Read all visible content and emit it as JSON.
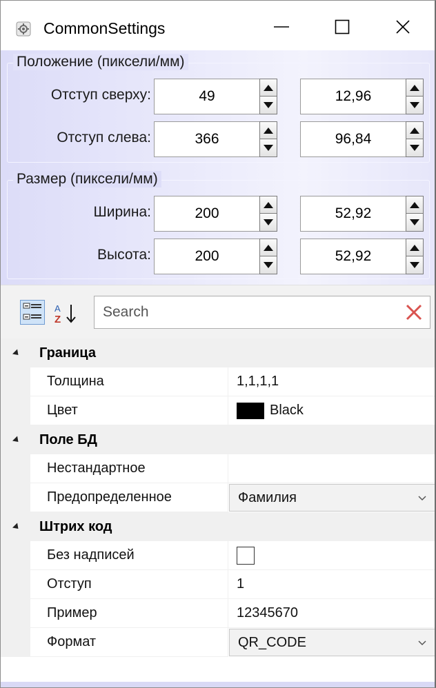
{
  "window": {
    "title": "CommonSettings",
    "icons": {
      "app": "settings-app-icon",
      "minimize": "minimize-icon",
      "maximize": "maximize-icon",
      "close": "close-icon"
    }
  },
  "position_group": {
    "title": "Положение (пиксели/мм)",
    "rows": [
      {
        "label": "Отступ сверху:",
        "pixels": "49",
        "mm": "12,96"
      },
      {
        "label": "Отступ слева:",
        "pixels": "366",
        "mm": "96,84"
      }
    ]
  },
  "size_group": {
    "title": "Размер (пиксели/мм)",
    "rows": [
      {
        "label": "Ширина:",
        "pixels": "200",
        "mm": "52,92"
      },
      {
        "label": "Высота:",
        "pixels": "200",
        "mm": "52,92"
      }
    ]
  },
  "property_grid": {
    "search_placeholder": "Search",
    "toolbar_icons": [
      "categorized-icon",
      "alphabetical-sort-icon",
      "clear-search-icon"
    ],
    "categories": [
      {
        "name": "Граница",
        "properties": [
          {
            "name": "Толщина",
            "value": "1,1,1,1"
          },
          {
            "name": "Цвет",
            "value": "Black",
            "color": "#000000"
          }
        ]
      },
      {
        "name": "Поле БД",
        "properties": [
          {
            "name": "Нестандартное",
            "value": ""
          },
          {
            "name": "Предопределенное",
            "value": "Фамилия"
          }
        ]
      },
      {
        "name": "Штрих код",
        "properties": [
          {
            "name": "Без надписей",
            "value": false
          },
          {
            "name": "Отступ",
            "value": "1"
          },
          {
            "name": "Пример",
            "value": "12345670"
          },
          {
            "name": "Формат",
            "value": "QR_CODE"
          }
        ]
      }
    ]
  },
  "colors": {
    "group_background": "#e2e2f9",
    "category_background": "#f0f0f0",
    "clear_icon": "#d9534f"
  }
}
